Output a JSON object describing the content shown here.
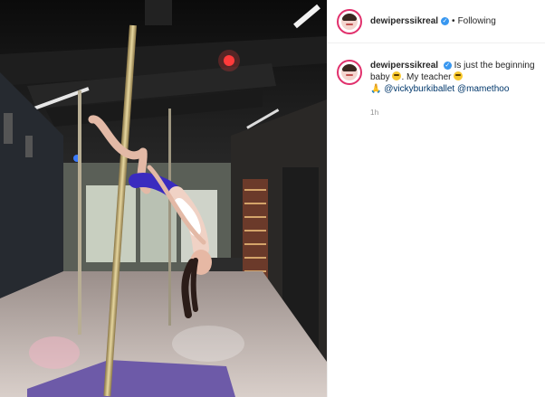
{
  "post": {
    "username": "dewiperssikreal",
    "verified_icon": "✓",
    "separator": "•",
    "follow_status": "Following"
  },
  "caption": {
    "username": "dewiperssikreal",
    "text_part1": "Is just the beginning baby",
    "text_part2": ". My teacher",
    "mention1": "@vickyburkiballet",
    "mention2": "@mamethoo",
    "pray_icon": "🙏"
  },
  "timestamp": "1h",
  "colors": {
    "verified": "#3897f0",
    "mention": "#00376b",
    "story_ring": "#e1306c"
  },
  "icons": [
    "verified-badge-icon",
    "smile-emoji-icon",
    "wink-emoji-icon",
    "pray-emoji-icon"
  ]
}
